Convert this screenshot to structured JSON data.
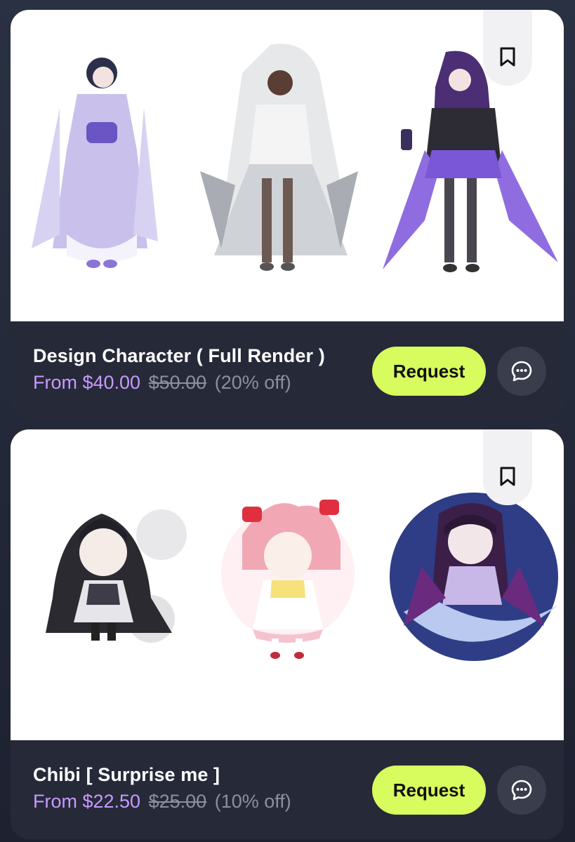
{
  "listings": [
    {
      "title": "Design Character ( Full Render )",
      "price": "From $40.00",
      "original_price": "$50.00",
      "discount": "(20% off)",
      "request_label": "Request",
      "bookmark_icon": "bookmark-icon",
      "chat_icon": "chat-bubble-icon",
      "images": [
        "lavender-kimono-character",
        "white-veil-gown-character",
        "purple-haired-lantern-character"
      ]
    },
    {
      "title": "Chibi [ Surprise me ]",
      "price": "From $22.50",
      "original_price": "$25.00",
      "discount": "(10% off)",
      "request_label": "Request",
      "bookmark_icon": "bookmark-icon",
      "chat_icon": "chat-bubble-icon",
      "images": [
        "black-haired-chibi",
        "pink-haired-chibi",
        "moon-crescent-chibi"
      ]
    }
  ],
  "colors": {
    "background": "#2a3142",
    "card": "#262938",
    "accent_button": "#d8fb5e",
    "price": "#c79aff",
    "muted": "#8c8f9c"
  }
}
